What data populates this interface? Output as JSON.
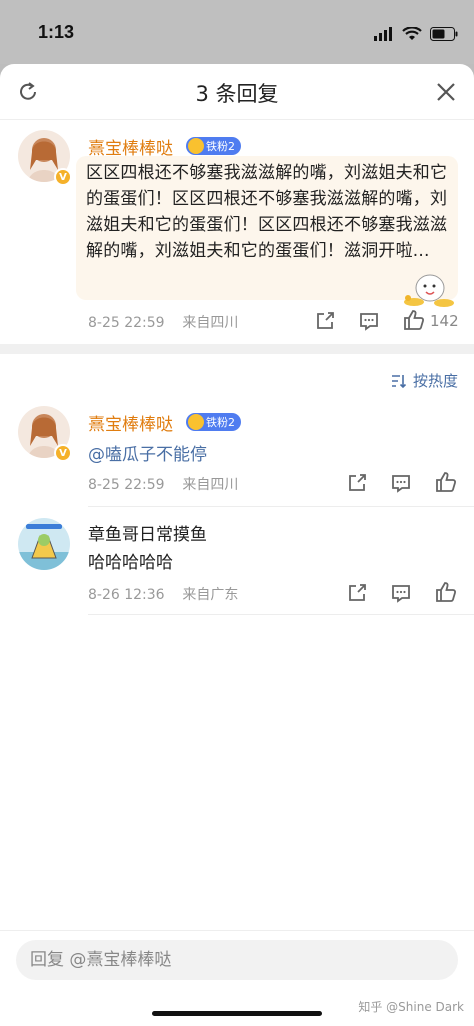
{
  "status_bar": {
    "time": "1:13"
  },
  "header": {
    "title": "3 条回复"
  },
  "main_comment": {
    "username": "熹宝棒棒哒",
    "fan_badge": "铁粉2",
    "text": "区区四根还不够塞我滋滋解的嘴，刘滋姐夫和它的蛋蛋们！区区四根还不够塞我滋滋解的嘴，刘滋姐夫和它的蛋蛋们！区区四根还不够塞我滋滋解的嘴，刘滋姐夫和它的蛋蛋们！滋洞开啦...",
    "date": "8-25 22:59",
    "location": "来自四川",
    "like_count": "142"
  },
  "sort": {
    "label": "按热度"
  },
  "replies": [
    {
      "username": "熹宝棒棒哒",
      "fan_badge": "铁粉2",
      "mention": "@嗑瓜子不能停",
      "date": "8-25 22:59",
      "location": "来自四川"
    },
    {
      "username": "章鱼哥日常摸鱼",
      "text": "哈哈哈哈哈",
      "date": "8-26 12:36",
      "location": "来自广东"
    }
  ],
  "input": {
    "placeholder": "回复 @熹宝棒棒哒"
  },
  "watermark": "知乎 @Shine Dark",
  "colors": {
    "accent_blue": "#4a6fa5",
    "username_orange": "#e07d10",
    "bubble_bg": "#fdf6ec"
  }
}
